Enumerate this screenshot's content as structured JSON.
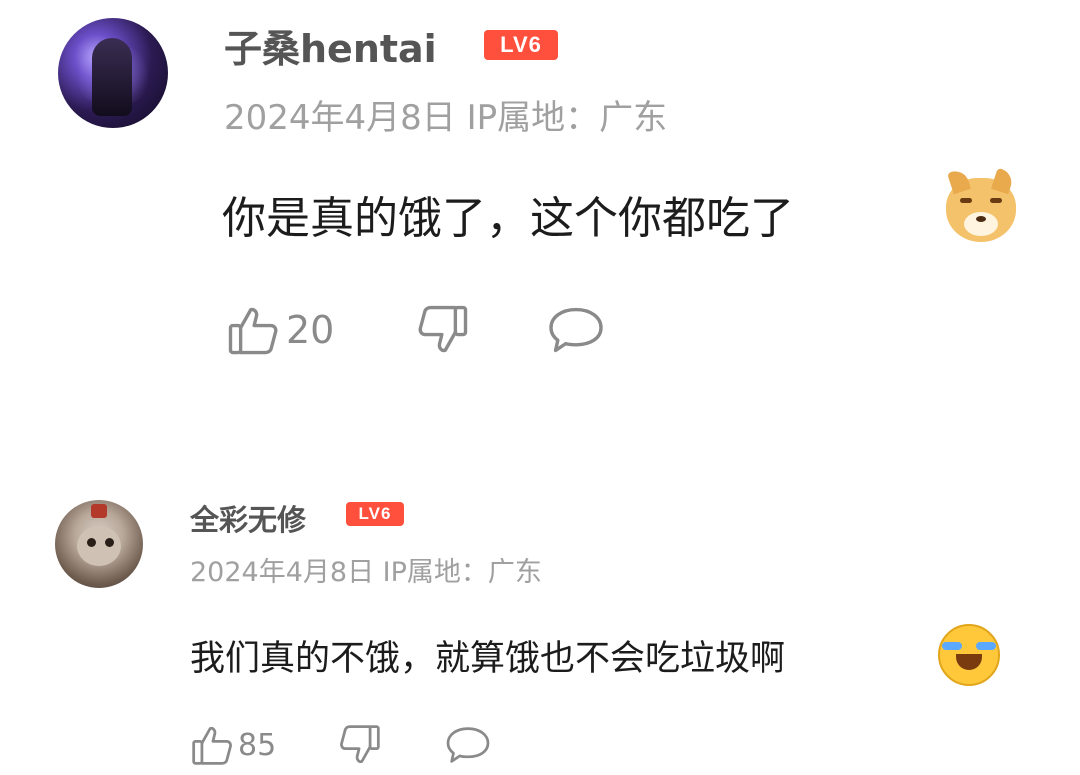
{
  "comments": [
    {
      "username": "子桑hentai",
      "level": "LV6",
      "meta": "2024年4月8日  IP属地：广东",
      "text": "你是真的饿了，这个你都吃了",
      "emoji": "doge-emoji",
      "likes": "20"
    },
    {
      "username": "全彩无修",
      "level": "LV6",
      "meta": "2024年4月8日  IP属地：广东",
      "text": "我们真的不饿，就算饿也不会吃垃圾啊",
      "emoji": "laugh-cry-emoji",
      "likes": "85"
    }
  ],
  "colors": {
    "level_badge": "#ff4f3d",
    "username": "#555555",
    "meta": "#a0a0a0",
    "body_text": "#1c1c1c",
    "icon": "#8a8a8a"
  }
}
